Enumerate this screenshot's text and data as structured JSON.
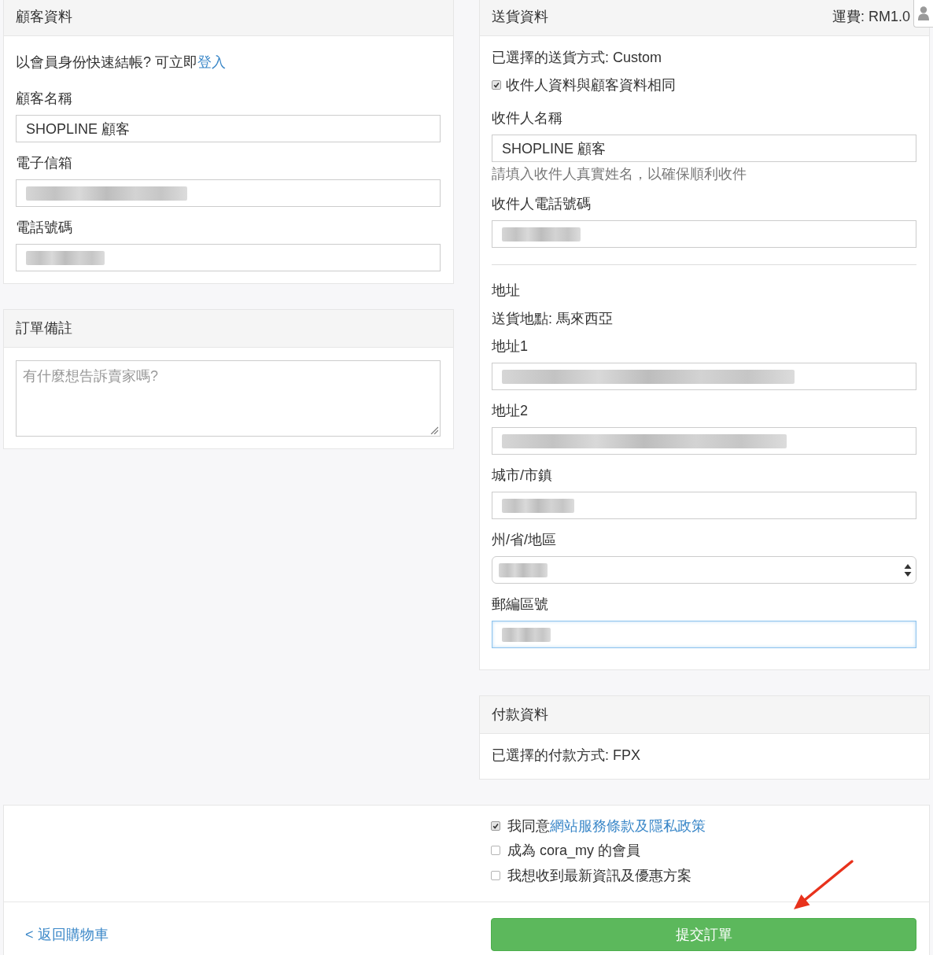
{
  "customer_panel": {
    "title": "顧客資料",
    "login_prompt": {
      "text": "以會員身份快速結帳? 可立即",
      "link": "登入"
    },
    "fields": [
      {
        "label": "顧客名稱",
        "kind": "text",
        "value": "SHOPLINE 顧客",
        "blurred": false,
        "focused": false
      },
      {
        "label": "電子信箱",
        "kind": "text",
        "blurred": true,
        "focused": false
      },
      {
        "label": "電話號碼",
        "kind": "text",
        "blurred": true,
        "focused": false
      }
    ]
  },
  "notes_panel": {
    "title": "訂單備註",
    "field": {
      "kind": "textarea",
      "placeholder": "有什麼想告訴賣家嗎?"
    }
  },
  "delivery_panel": {
    "title": "送貨資料",
    "fee": "運費: RM1.0",
    "method": "已選擇的送貨方式: Custom",
    "same_as_customer": {
      "label": "收件人資料與顧客資料相同",
      "checked": true
    },
    "recipient_fields": [
      {
        "label": "收件人名稱",
        "kind": "text",
        "value": "SHOPLINE 顧客",
        "blurred": false,
        "help": "請填入收件人真實姓名，以確保順利收件",
        "focused": false
      },
      {
        "label": "收件人電話號碼",
        "kind": "text",
        "blurred": true,
        "focused": false
      }
    ],
    "address_heading": "地址",
    "destination": "送貨地點: 馬來西亞",
    "address_fields": [
      {
        "label": "地址1",
        "kind": "text",
        "blurred": true,
        "focused": false
      },
      {
        "label": "地址2",
        "kind": "text",
        "blurred": true,
        "focused": false
      },
      {
        "label": "城市/市鎮",
        "kind": "text",
        "blurred": true,
        "focused": false
      },
      {
        "label": "州/省/地區",
        "kind": "select",
        "blurred": true,
        "focused": false
      },
      {
        "label": "郵編區號",
        "kind": "text",
        "blurred": true,
        "focused": true
      }
    ]
  },
  "payment_panel": {
    "title": "付款資料",
    "method": "已選擇的付款方式: FPX"
  },
  "agreements": [
    {
      "text": "我同意",
      "link": "網站服務條款及隱私政策",
      "checked": true
    },
    {
      "text": "成為 cora_my 的會員",
      "checked": false
    },
    {
      "text": "我想收到最新資訊及優惠方案",
      "checked": false
    }
  ],
  "footer": {
    "back_link": "< 返回購物車",
    "submit_button": "提交訂單"
  }
}
